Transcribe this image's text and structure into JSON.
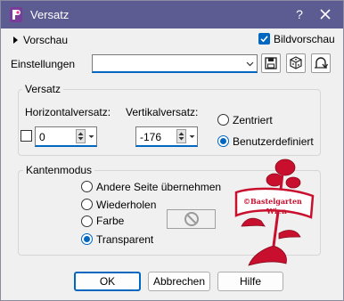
{
  "window": {
    "title": "Versatz",
    "help": "?"
  },
  "preview": {
    "label": "Vorschau",
    "bild_label": "Bildvorschau",
    "bild_checked": true
  },
  "settings": {
    "label": "Einstellungen",
    "value": ""
  },
  "offset": {
    "group_title": "Versatz",
    "horizontal_label": "Horizontalversatz:",
    "horizontal_value": "0",
    "vertical_label": "Vertikalversatz:",
    "vertical_value": "-176",
    "centered_label": "Zentriert",
    "custom_label": "Benutzerdefiniert",
    "selected": "custom"
  },
  "edge": {
    "group_title": "Kantenmodus",
    "options": [
      "Andere Seite übernehmen",
      "Wiederholen",
      "Farbe",
      "Transparent"
    ],
    "selected": "Transparent"
  },
  "watermark": {
    "line1": "©Bastelgarten",
    "line2": "Wien"
  },
  "buttons": {
    "ok": "OK",
    "cancel": "Abbrechen",
    "help": "Hilfe"
  },
  "colors": {
    "titlebar": "#5c5c93",
    "accent": "#0067c0",
    "watermark": "#c8102e"
  }
}
